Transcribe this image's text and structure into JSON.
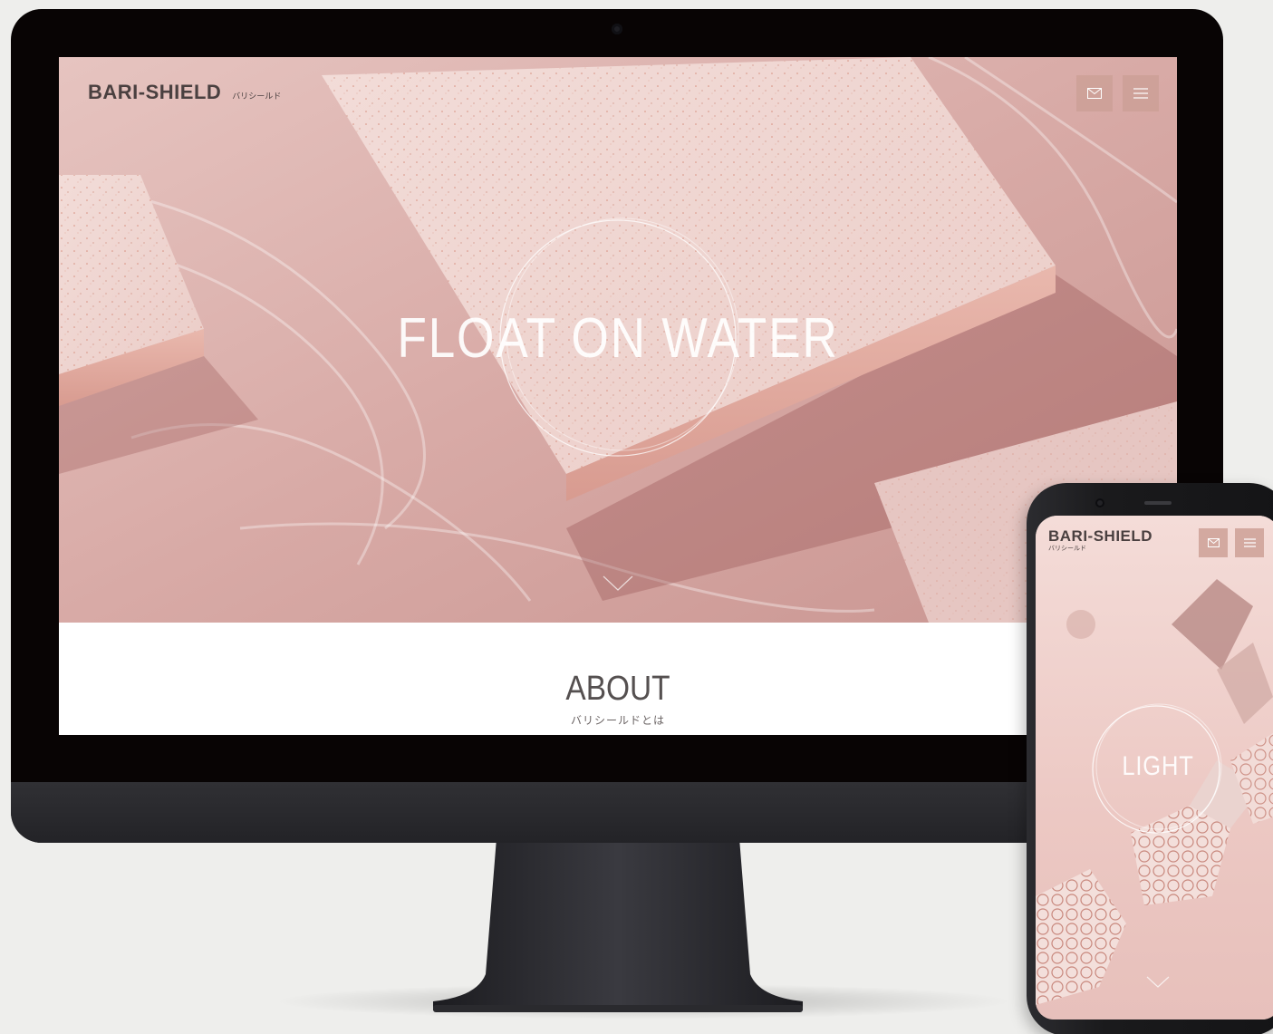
{
  "desktop": {
    "logo": "BARI-SHIELD",
    "logo_sub": "バリシールド",
    "hero_title": "FLOAT ON WATER",
    "about_title": "ABOUT",
    "about_subtitle": "バリシールドとは"
  },
  "mobile": {
    "logo": "BARI-SHIELD",
    "logo_sub": "バリシールド",
    "hero_title": "LIGHT"
  },
  "icons": {
    "mail": "mail-icon",
    "menu": "hamburger-menu-icon",
    "scroll": "chevron-down-icon"
  },
  "colors": {
    "background": "#eeeeec",
    "hero_pink": "#d5a9a6",
    "button_pink": "#cda096",
    "logo_text": "#4a4040"
  }
}
